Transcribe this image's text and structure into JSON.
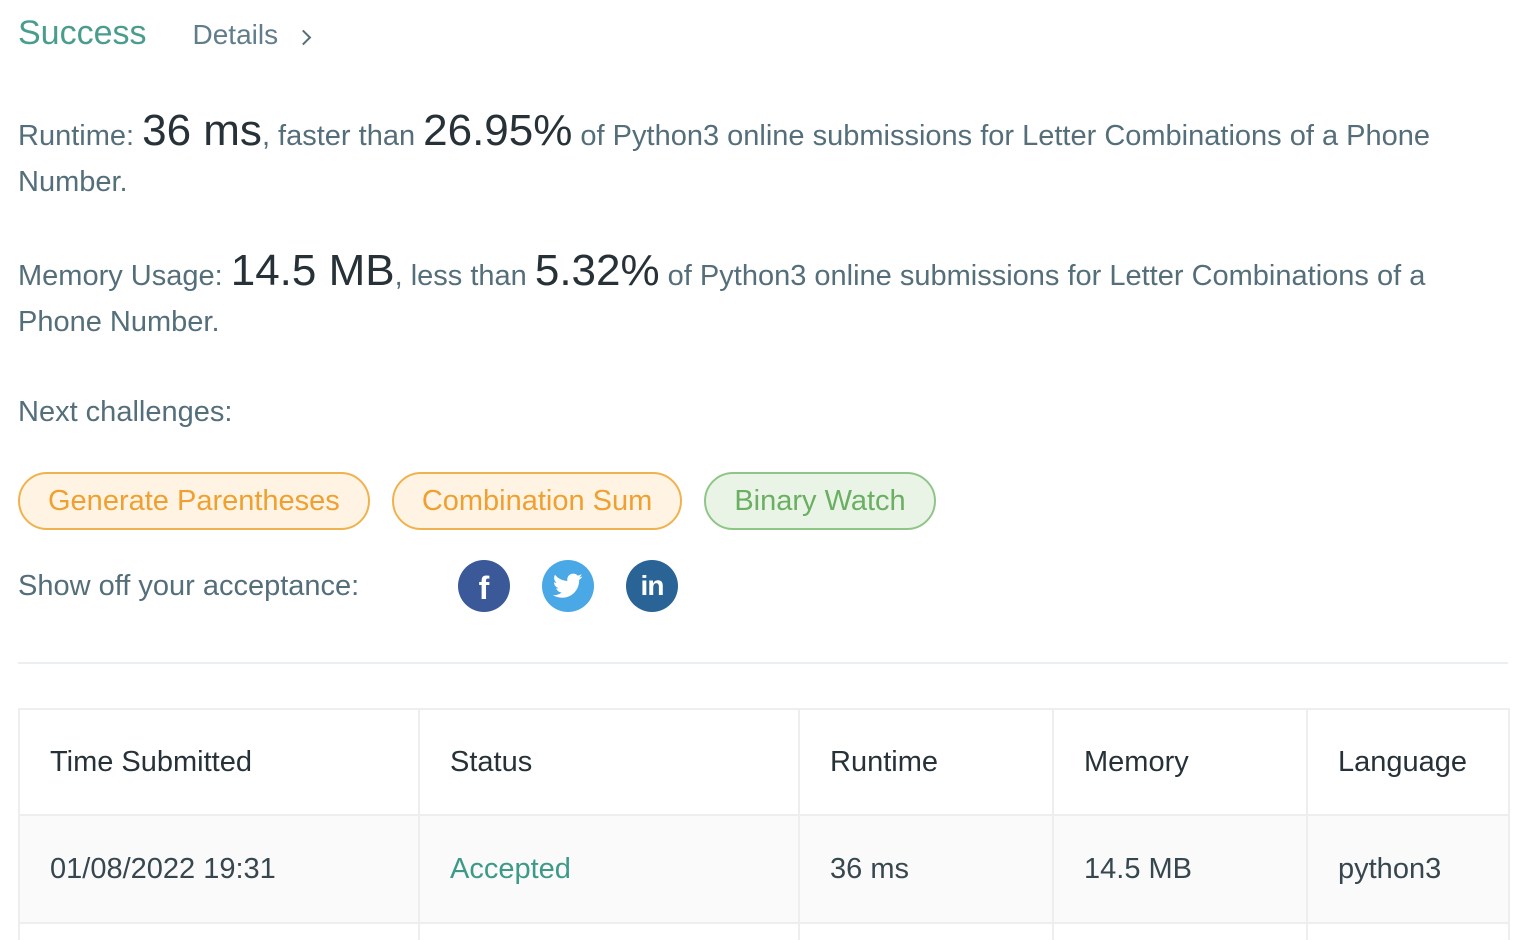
{
  "header": {
    "status": "Success",
    "details_label": "Details"
  },
  "runtime": {
    "label": "Runtime: ",
    "value": "36 ms",
    "mid": ", faster than ",
    "percent": "26.95%",
    "suffix": " of Python3 online submissions for Letter Combinations of a Phone Number."
  },
  "memory": {
    "label": "Memory Usage: ",
    "value": "14.5 MB",
    "mid": ", less than ",
    "percent": "5.32%",
    "suffix": " of Python3 online submissions for Letter Combinations of a Phone Number."
  },
  "next": {
    "label": "Next challenges:",
    "items": [
      {
        "label": "Generate Parentheses",
        "difficulty": "medium"
      },
      {
        "label": "Combination Sum",
        "difficulty": "medium"
      },
      {
        "label": "Binary Watch",
        "difficulty": "easy"
      }
    ]
  },
  "share": {
    "label": "Show off your acceptance:",
    "networks": [
      {
        "icon": "facebook-icon",
        "glyph": "f",
        "color": "#3b5998"
      },
      {
        "icon": "twitter-icon",
        "color": "#4aa8e6"
      },
      {
        "icon": "linkedin-icon",
        "glyph": "in",
        "color": "#2a6496"
      }
    ]
  },
  "submissions": {
    "columns": [
      "Time Submitted",
      "Status",
      "Runtime",
      "Memory",
      "Language"
    ],
    "rows": [
      [
        "01/08/2022 19:31",
        "Accepted",
        "36 ms",
        "14.5 MB",
        "python3"
      ]
    ]
  },
  "colors": {
    "success": "#4a9d8e",
    "medium": "#f0a030",
    "easy": "#6aaf62",
    "accepted": "#3d9a88"
  }
}
